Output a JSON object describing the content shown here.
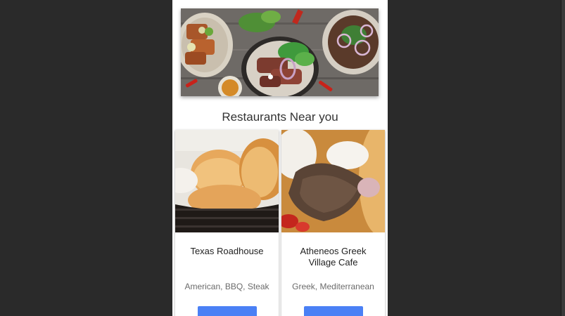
{
  "colors": {
    "background": "#2a2a2a",
    "surface": "#ffffff",
    "accent": "#4a80f5",
    "title_text": "#333333",
    "muted_text": "#6b6b6b"
  },
  "hero": {
    "image": "food-platters-photo",
    "carousel_active_index": 0
  },
  "section": {
    "title": "Restaurants Near you"
  },
  "restaurants": [
    {
      "name": "Texas Roadhouse",
      "cuisine": "American, BBQ, Steak",
      "image": "bread-rolls-basket-photo"
    },
    {
      "name": "Atheneos Greek Village Cafe",
      "cuisine": "Greek, Mediterranean",
      "image": "gyro-pita-photo"
    }
  ]
}
